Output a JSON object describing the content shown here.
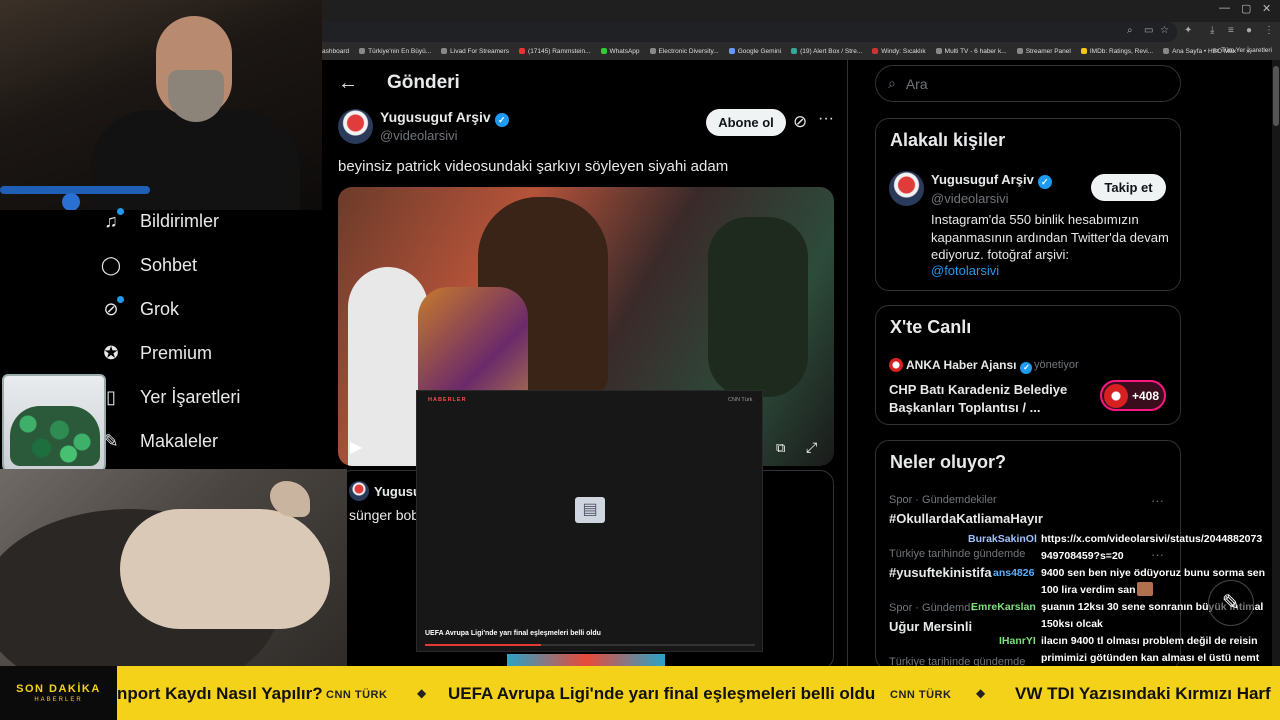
{
  "browser": {
    "bookmarks": [
      "ashboard",
      "Türkiye'nin En Büyü...",
      "Livad For Streamers",
      "(17145) Rammstein...",
      "WhatsApp",
      "Electronic Diversity...",
      "Google Gemini",
      "(19) Alert Box / Stre...",
      "Windy: Sıcaklık",
      "Multi TV - 6 haber k...",
      "Streamer Panel",
      "IMDb: Ratings, Revi...",
      "Ana Sayfa • HBO Max"
    ],
    "bookmarks_overflow": "»",
    "all_bookmarks": "Tüm Yer İşaretleri"
  },
  "nav": {
    "items": [
      {
        "label": "Bildirimler",
        "icon": "bell-icon"
      },
      {
        "label": "Sohbet",
        "icon": "chat-icon"
      },
      {
        "label": "Grok",
        "icon": "grok-icon"
      },
      {
        "label": "Premium",
        "icon": "premium-badge-icon"
      },
      {
        "label": "Yer İşaretleri",
        "icon": "bookmark-icon"
      },
      {
        "label": "Makaleler",
        "icon": "article-icon"
      }
    ]
  },
  "post": {
    "page_title": "Gönderi",
    "author_name": "Yugusuguf Arşiv",
    "author_handle": "@videolarsivi",
    "subscribe_label": "Abone ol",
    "text": "beyinsiz patrick videosundaki şarkıyı söyleyen siyahi adam",
    "reply_name": "Yugusu",
    "reply_text": "sünger bob"
  },
  "popup": {
    "brand": "HABERLER",
    "source": "CNN Türk",
    "headline": "UEFA Avrupa Ligi'nde yarı final eşleşmeleri belli oldu",
    "progress": 0.35
  },
  "sidebar": {
    "search_placeholder": "Ara",
    "people": {
      "title": "Alakalı kişiler",
      "name": "Yugusuguf Arşiv",
      "handle": "@videolarsivi",
      "follow_label": "Takip et",
      "bio": "Instagram'da 550 binlik hesabımızın kapanmasının ardından Twitter'da devam ediyoruz. fotoğraf arşivi:",
      "link": "@fotolarsivi"
    },
    "live": {
      "title": "X'te Canlı",
      "host": "ANKA Haber Ajansı",
      "host_role": "yönetiyor",
      "space_title": "CHP Batı Karadeniz Belediye Başkanları Toplantısı / ...",
      "listeners": "+408"
    },
    "trends": {
      "title": "Neler oluyor?",
      "items": [
        {
          "category": "Spor · Gündemdekiler",
          "name": "#OkullardaKatliamaHayır"
        },
        {
          "category": "Türkiye tarihinde gündemde",
          "name": "#yusuftekinistifa"
        },
        {
          "category": "Spor · Gündemde",
          "name": "Uğur Mersinli"
        },
        {
          "category": "Türkiye tarihinde gündemde",
          "name": ""
        }
      ]
    }
  },
  "chat": [
    {
      "user": "BurakSakinOl",
      "color": "#9fc3ff",
      "lines": [
        "https://x.com/videolarsivi/status/2044882073",
        "949708459?s=20"
      ]
    },
    {
      "user": "ans4826",
      "color": "#5ab0ff",
      "lines": [
        "9400 sen ben niye ödüyoruz bunu sorma sen",
        "100 lira verdim san"
      ]
    },
    {
      "user": "EmreKarslan",
      "color": "#7de07d",
      "lines": [
        "şuanın 12ksı 30 sene sonranın büyük ihtimal",
        "150ksı olcak"
      ]
    },
    {
      "user": "IHanrYI",
      "color": "#7de07d",
      "lines": [
        "ilacın 9400 tl olması problem değil de reisin",
        "primimizi götünden kan alması el üstü nemt"
      ]
    }
  ],
  "ticker": {
    "badge_line1": "SON DAKİKA",
    "badge_line2": "HABERLER",
    "items": [
      {
        "text": "nport Kaydı Nasıl Yapılır?",
        "source": "CNN TÜRK"
      },
      {
        "text": "UEFA Avrupa Ligi'nde yarı final eşleşmeleri belli oldu",
        "source": "CNN TÜRK"
      },
      {
        "text": "VW TDI Yazısındaki Kırmızı Harf",
        "source": ""
      }
    ],
    "separator": "◆"
  }
}
